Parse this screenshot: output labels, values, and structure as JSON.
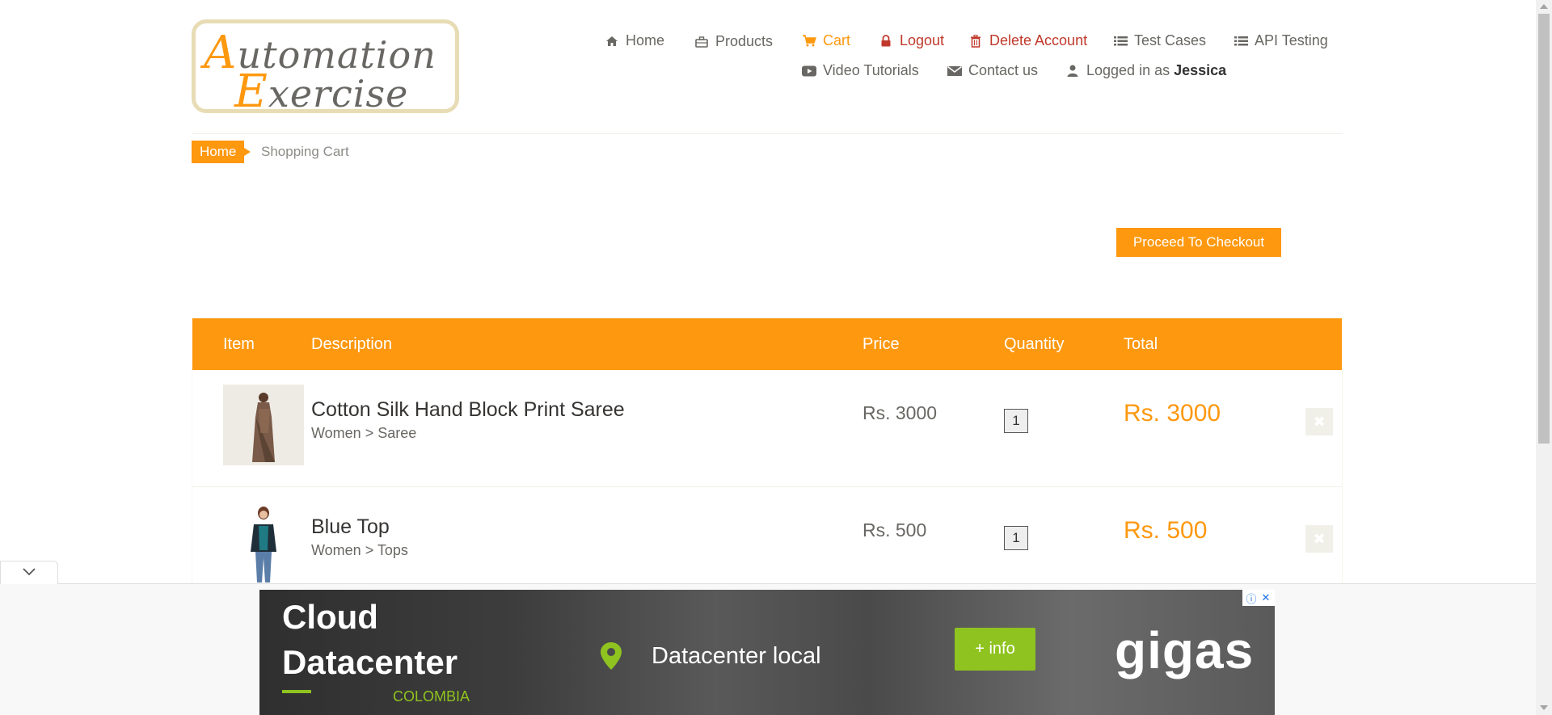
{
  "header": {
    "logo": {
      "line1_first": "A",
      "line1_rest": "utomation",
      "line2_first": "E",
      "line2_rest": "xercise"
    },
    "nav": [
      {
        "label": "Home",
        "icon": "home-icon"
      },
      {
        "label": "Products",
        "icon": "briefcase-icon"
      },
      {
        "label": "Cart",
        "icon": "cart-icon"
      },
      {
        "label": "Logout",
        "icon": "lock-icon"
      },
      {
        "label": "Delete Account",
        "icon": "trash-icon"
      },
      {
        "label": "Test Cases",
        "icon": "list-icon"
      },
      {
        "label": "API Testing",
        "icon": "list-icon"
      },
      {
        "label": "Video Tutorials",
        "icon": "youtube-icon"
      },
      {
        "label": "Contact us",
        "icon": "envelope-icon"
      },
      {
        "label": "Logged in as",
        "icon": "user-icon",
        "username": "Jessica"
      }
    ]
  },
  "breadcrumb": {
    "home": "Home",
    "current": "Shopping Cart"
  },
  "checkout_button": "Proceed To Checkout",
  "table": {
    "headers": [
      "Item",
      "Description",
      "Price",
      "Quantity",
      "Total"
    ],
    "rows": [
      {
        "title": "Cotton Silk Hand Block Print Saree",
        "category": "Women > Saree",
        "price": "Rs. 3000",
        "quantity": "1",
        "total": "Rs. 3000",
        "delete_icon": "close-icon"
      },
      {
        "title": "Blue Top",
        "category": "Women > Tops",
        "price": "Rs. 500",
        "quantity": "1",
        "total": "Rs. 500",
        "delete_icon": "close-icon"
      }
    ]
  },
  "ad": {
    "title_line1": "Cloud",
    "title_line2": "Datacenter",
    "country": "COLOMBIA",
    "tagline": "Datacenter local",
    "cta": "+ info",
    "brand": "gigas",
    "choices_icon": "info-icon",
    "close_icon": "close-icon"
  },
  "colors": {
    "accent": "#fe980f",
    "danger": "#c0392b",
    "ad_green": "#8fc31f"
  }
}
